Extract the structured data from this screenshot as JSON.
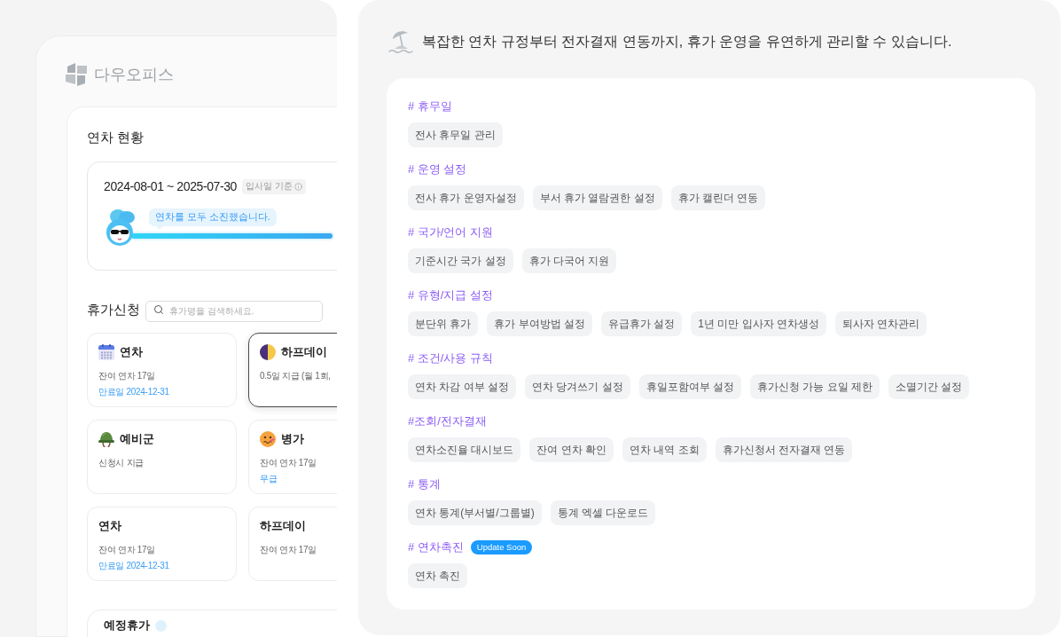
{
  "app": {
    "logo": "다우오피스",
    "status": {
      "title": "연차 현황",
      "period": "2024-08-01 ~ 2025-07-30",
      "basis": "입사일 기준",
      "message": "연차를 모두 소진했습니다.",
      "level": 1
    },
    "leave": {
      "title": "휴가신청",
      "search": {
        "placeholder": "휴가명을 검색하세요."
      },
      "cards": [
        {
          "kind": "annual",
          "title": "연차",
          "detail": "잔여 연차 17일",
          "note": "만료일 2024-12-31",
          "selected": false
        },
        {
          "kind": "half-day",
          "title": "하프데이",
          "detail": "0.5일 지급 (월 1회,",
          "selected": true
        },
        {
          "kind": "reserve",
          "title": "예비군",
          "detail": "신청시 지급",
          "selected": false
        },
        {
          "kind": "sick",
          "title": "병가",
          "detail": "잔여 연차 17일",
          "note": "무급",
          "selected": false
        },
        {
          "kind": "plain",
          "title": "연차",
          "detail": "잔여 연차 17일",
          "note": "만료일 2024-12-31",
          "selected": false
        },
        {
          "kind": "plain",
          "title": "하프데이",
          "detail": "잔여 연차 17일",
          "selected": false
        }
      ]
    },
    "upcoming": {
      "title": "예정휴가"
    }
  },
  "features": {
    "intro": "복잡한 연차 규정부터 전자결재 연동까지, 휴가 운영을 유연하게 관리할 수 있습니다.",
    "sections": [
      {
        "heading": "# 휴무일",
        "tags": [
          "전사 휴무일 관리"
        ]
      },
      {
        "heading": "# 운영 설정",
        "tags": [
          "전사 휴가 운영자설정",
          "부서 휴가 열람권한 설정",
          "휴가 캘린더 연동"
        ]
      },
      {
        "heading": "# 국가/언어 지원",
        "tags": [
          "기준시간 국가 설정",
          "휴가 다국어 지원"
        ]
      },
      {
        "heading": "# 유형/지급 설정",
        "tags": [
          "분단위 휴가",
          "휴가 부여방법 설정",
          "유급휴가 설정",
          "1년 미만 입사자 연차생성",
          "퇴사자 연차관리"
        ]
      },
      {
        "heading": "# 조건/사용 규칙",
        "tags": [
          "연차 차감 여부 설정",
          "연차 당겨쓰기 설정",
          "휴일포함여부 설정",
          "휴가신청 가능 요일 제한",
          "소멸기간 설정"
        ]
      },
      {
        "heading": "#조회/전자결재",
        "tags": [
          "연차소진율 대시보드",
          "잔여 연차 확인",
          "연차 내역 조회",
          "휴가신청서 전자결재 연동"
        ]
      },
      {
        "heading": "# 통계",
        "tags": [
          "연차 통계(부서별/그룹별)",
          "통계 엑셀 다운로드"
        ]
      },
      {
        "heading": "# 연차촉진",
        "badge": "Update Soon",
        "tags": [
          "연차 촉진"
        ]
      }
    ]
  }
}
